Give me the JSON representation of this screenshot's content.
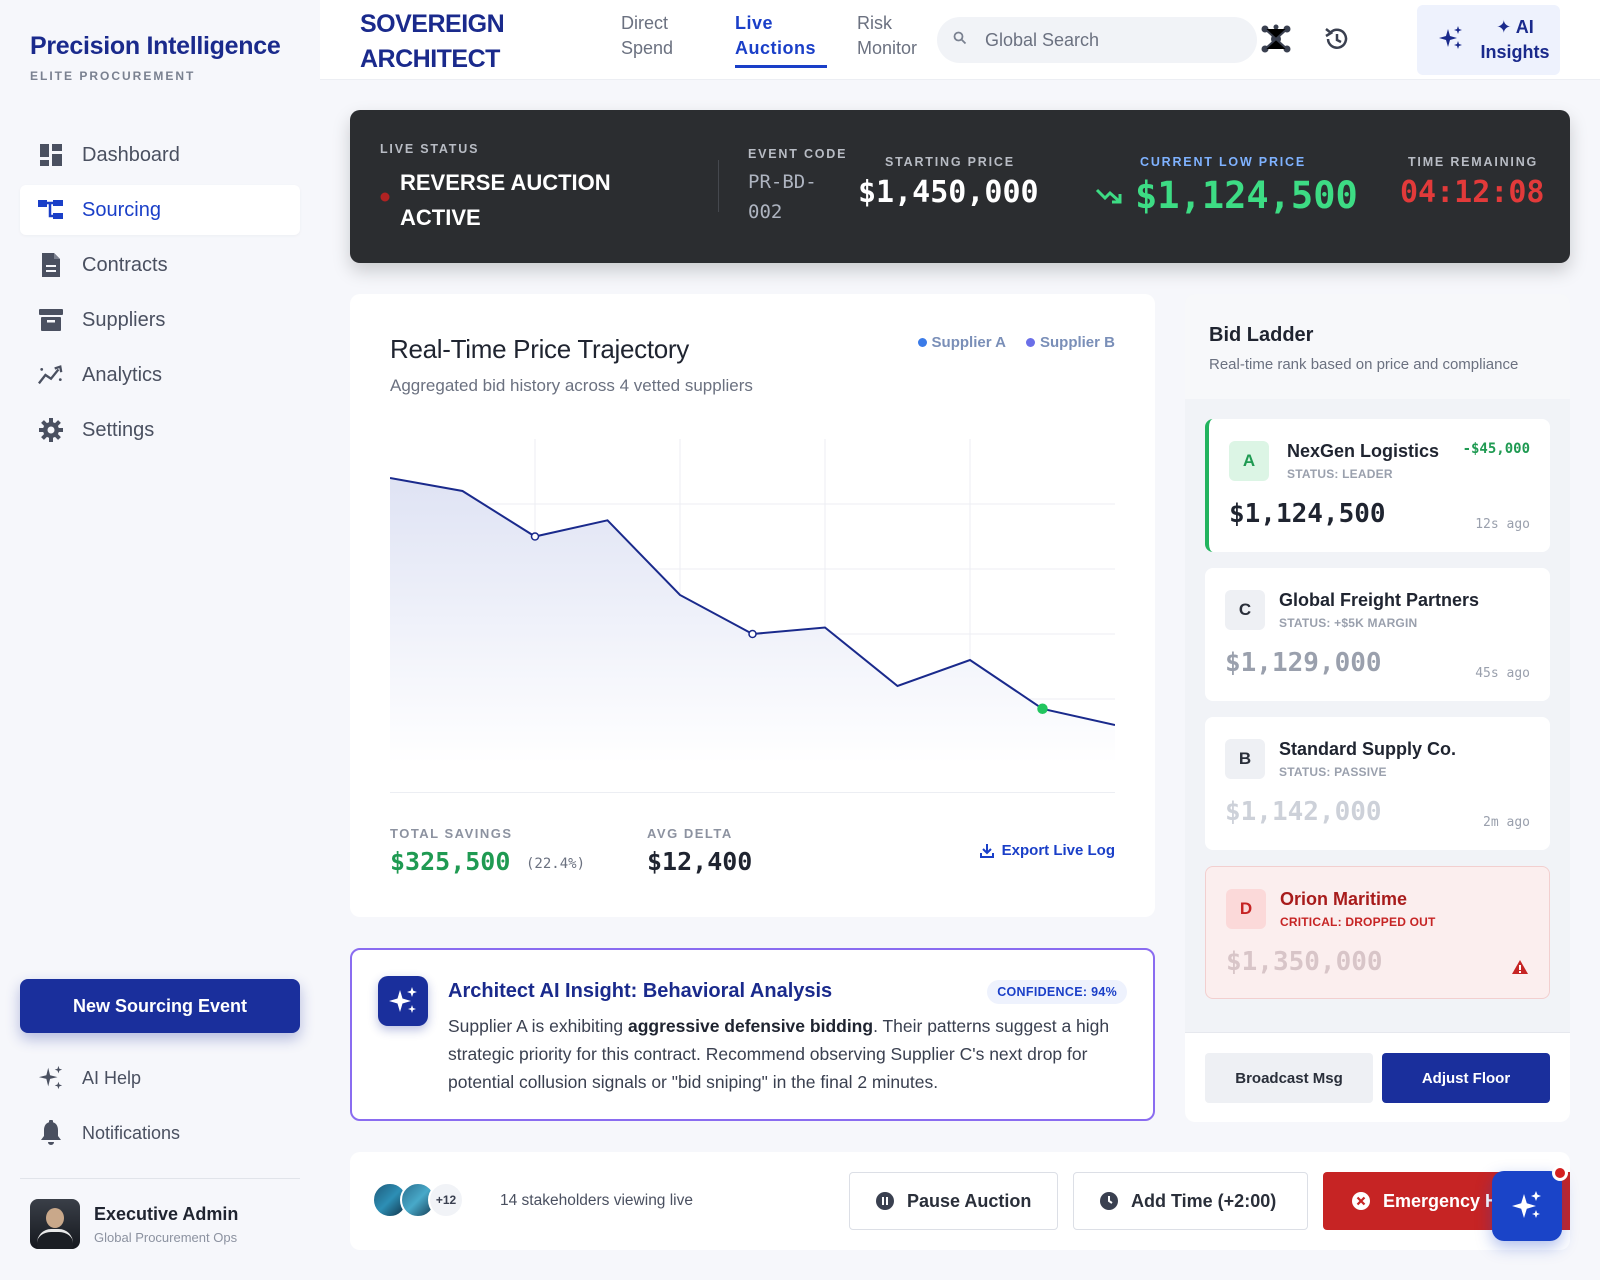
{
  "sidebar": {
    "brand": "Precision Intelligence",
    "brand_sub": "ELITE PROCUREMENT",
    "items": [
      {
        "label": "Dashboard",
        "icon": "dashboard-icon"
      },
      {
        "label": "Sourcing",
        "icon": "sourcing-icon",
        "active": true
      },
      {
        "label": "Contracts",
        "icon": "contracts-icon"
      },
      {
        "label": "Suppliers",
        "icon": "suppliers-icon"
      },
      {
        "label": "Analytics",
        "icon": "analytics-icon"
      },
      {
        "label": "Settings",
        "icon": "settings-icon"
      }
    ],
    "new_event": "New Sourcing Event",
    "ai_help": "AI Help",
    "notifications": "Notifications",
    "user": {
      "name": "Executive Admin",
      "role": "Global Procurement Ops"
    }
  },
  "header": {
    "logo_line1": "SOVEREIGN",
    "logo_line2": "ARCHITECT",
    "tabs": [
      {
        "line1": "Direct",
        "line2": "Spend"
      },
      {
        "line1": "Live",
        "line2": "Auctions",
        "active": true
      },
      {
        "line1": "Risk",
        "line2": "Monitor"
      }
    ],
    "search_placeholder": "Global Search",
    "ai_line1": "✦ AI",
    "ai_line2": "Insights"
  },
  "banner": {
    "live_label": "LIVE STATUS",
    "status_line1": "REVERSE AUCTION",
    "status_line2": "ACTIVE",
    "event_label": "EVENT CODE",
    "event_line1": "PR-BD-",
    "event_line2": "002",
    "start_label": "STARTING PRICE",
    "start_price": "$1,450,000",
    "current_label": "CURRENT LOW PRICE",
    "current_price": "$1,124,500",
    "time_label": "TIME REMAINING",
    "time_remaining": "04:12:08"
  },
  "chart": {
    "title": "Real-Time Price Trajectory",
    "subtitle": "Aggregated bid history across 4 vetted suppliers",
    "legend": [
      "Supplier A",
      "Supplier B"
    ],
    "savings_label": "TOTAL SAVINGS",
    "savings_value": "$325,500",
    "savings_pct": "(22.4%)",
    "delta_label": "AVG DELTA",
    "delta_value": "$12,400",
    "export_label": "Export Live Log"
  },
  "chart_data": {
    "type": "area",
    "x": [
      0,
      1,
      2,
      3,
      4,
      5,
      6,
      7,
      8,
      9,
      10
    ],
    "series": [
      {
        "values": [
          88,
          84,
          70,
          75,
          52,
          40,
          42,
          24,
          32,
          17,
          12
        ]
      }
    ],
    "markers": [
      2,
      5,
      9
    ],
    "grid": true,
    "ylim": [
      0,
      100
    ],
    "legend": "top-right",
    "colors": {
      "line": "#1a2a8c",
      "fill": "#e6e9f6",
      "marker_end": "#22c55e"
    }
  },
  "insight": {
    "title": "Architect AI Insight: Behavioral Analysis",
    "badge": "CONFIDENCE: 94%",
    "text_pre": "Supplier A is exhibiting ",
    "text_bold": "aggressive defensive bidding",
    "text_post": ". Their patterns suggest a high strategic priority for this contract. Recommend observing Supplier C's next drop for potential collusion signals or \"bid sniping\" in the final 2 minutes."
  },
  "ladder": {
    "title": "Bid Ladder",
    "subtitle": "Real-time rank based on price and compliance",
    "bids": [
      {
        "letter": "A",
        "name": "NexGen Logistics",
        "status": "STATUS: LEADER",
        "price": "$1,124,500",
        "time": "12s ago",
        "delta": "-$45,000"
      },
      {
        "letter": "C",
        "name": "Global Freight Partners",
        "status": "STATUS: +$5K MARGIN",
        "price": "$1,129,000",
        "time": "45s ago"
      },
      {
        "letter": "B",
        "name": "Standard Supply Co.",
        "status": "STATUS: PASSIVE",
        "price": "$1,142,000",
        "time": "2m ago"
      },
      {
        "letter": "D",
        "name": "Orion Maritime",
        "status": "CRITICAL: DROPPED OUT",
        "price": "$1,350,000"
      }
    ],
    "broadcast": "Broadcast Msg",
    "adjust": "Adjust Floor"
  },
  "bottom": {
    "more_count": "+12",
    "viewers": "14 stakeholders viewing live",
    "pause": "Pause Auction",
    "add_time": "Add Time (+2:00)",
    "emergency": "Emergency Halt"
  },
  "colors": {
    "brand": "#1a2a8c",
    "accent": "#1a3fc8",
    "success": "#22b35e",
    "danger": "#c62424"
  }
}
